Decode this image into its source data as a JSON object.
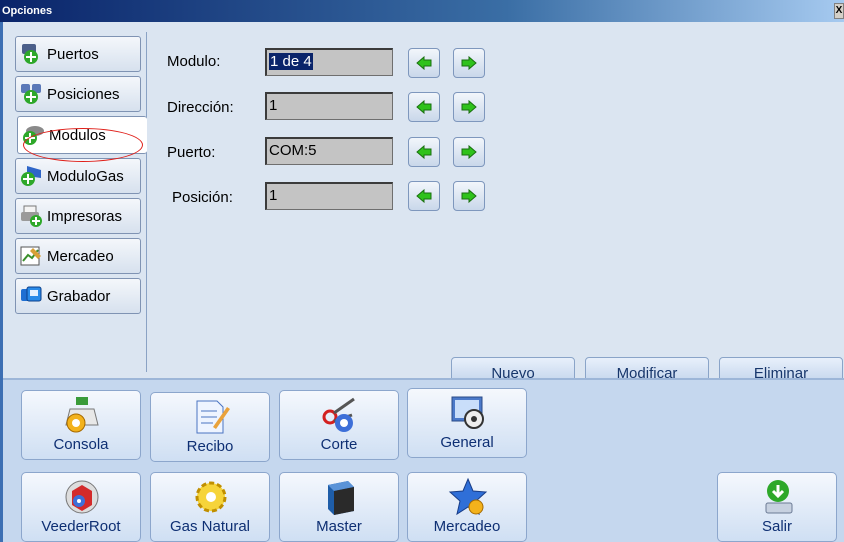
{
  "window": {
    "title": "Opciones",
    "close_label": "X"
  },
  "sidebar": {
    "items": [
      {
        "label": "Puertos",
        "icon": "ports-icon"
      },
      {
        "label": "Posiciones",
        "icon": "positions-icon"
      },
      {
        "label": "Modulos",
        "icon": "modules-icon",
        "selected": true
      },
      {
        "label": "ModuloGas",
        "icon": "gas-module-icon"
      },
      {
        "label": "Impresoras",
        "icon": "printer-icon"
      },
      {
        "label": "Mercadeo",
        "icon": "marketing-icon"
      },
      {
        "label": "Grabador",
        "icon": "recorder-icon"
      }
    ]
  },
  "form": {
    "modulo": {
      "label": "Modulo:",
      "value": "1 de 4"
    },
    "direccion": {
      "label": "Dirección:",
      "value": "1"
    },
    "puerto": {
      "label": "Puerto:",
      "value": "COM:5"
    },
    "posicion": {
      "label": "Posición:",
      "value": "1"
    }
  },
  "actions": {
    "nuevo": "Nuevo",
    "modificar": "Modificar",
    "eliminar": "Eliminar"
  },
  "bottom": {
    "row1": [
      {
        "label": "Consola",
        "icon": "console-icon"
      },
      {
        "label": "Recibo",
        "icon": "receipt-icon"
      },
      {
        "label": "Corte",
        "icon": "cut-icon"
      },
      {
        "label": "General",
        "icon": "general-icon"
      }
    ],
    "row2": [
      {
        "label": "VeederRoot",
        "icon": "veederroot-icon"
      },
      {
        "label": "Gas Natural",
        "icon": "natural-gas-icon"
      },
      {
        "label": "Master",
        "icon": "master-icon"
      },
      {
        "label": "Mercadeo",
        "icon": "marketing-star-icon"
      }
    ],
    "exit": {
      "label": "Salir",
      "icon": "exit-icon"
    }
  },
  "colors": {
    "accent": "#3d6fb3",
    "panel": "#dbe5f1",
    "arrow": "#2fc21b",
    "highlight": "#e0201a"
  }
}
